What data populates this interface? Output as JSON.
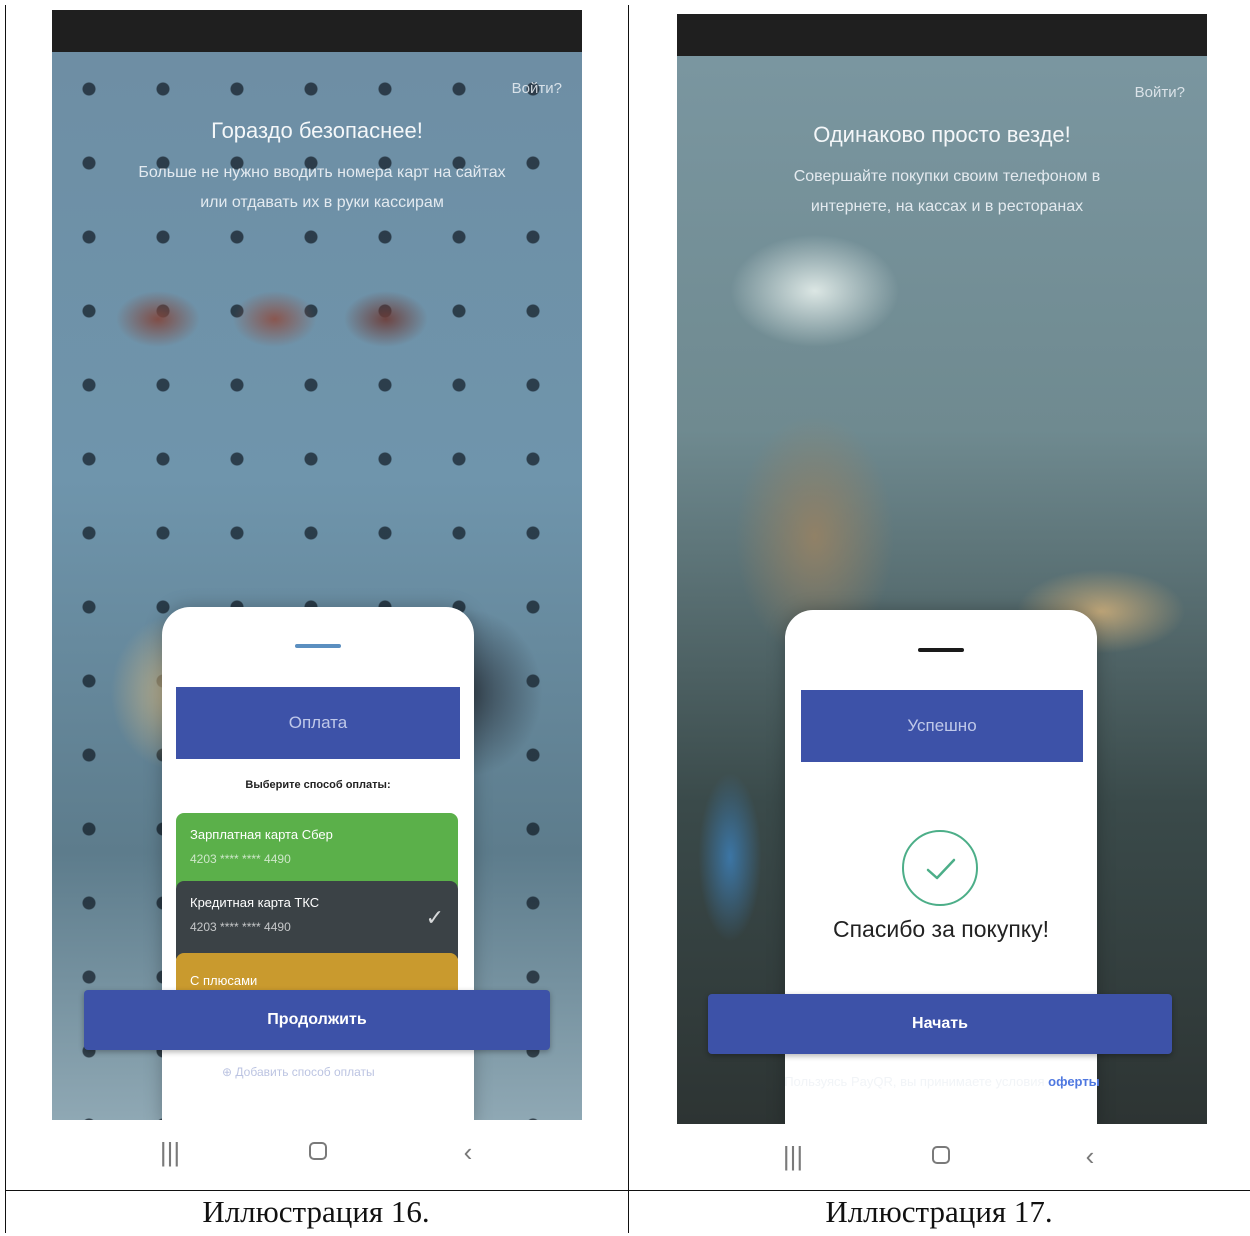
{
  "screen16": {
    "login_link": "Войти?",
    "headline": "Гораздо безопаснее!",
    "subtext": "Больше не нужно вводить номера карт на сайтах или отдавать их в руки кассирам",
    "app_bar_title": "Оплата",
    "select_label": "Выберите способ оплаты:",
    "cards": [
      {
        "name": "Зарплатная карта Сбер",
        "number": "4203 **** **** 4490",
        "color": "#5bb04a"
      },
      {
        "name": "Кредитная карта ТКС",
        "number": "4203 **** **** 4490",
        "color": "#3b4246",
        "selected": true
      },
      {
        "name": "С плюсами",
        "number": "",
        "color": "#c99a2e"
      }
    ],
    "continue_button": "Продолжить",
    "add_method": "Добавить способ оплаты",
    "caption": "Иллюстрация 16."
  },
  "screen17": {
    "login_link": "Войти?",
    "headline": "Одинаково просто везде!",
    "subtext": "Совершайте покупки своим телефоном в интернете, на кассах и в ресторанах",
    "app_bar_title": "Успешно",
    "thanks_message": "Спасибо за покупку!",
    "start_button": "Начать",
    "terms_prefix": "Пользуясь PayQR, вы принимаете условия",
    "terms_link": "оферты",
    "caption": "Иллюстрация 17."
  },
  "colors": {
    "brand_blue": "#3d52a8",
    "success_green": "#4cae88",
    "status_bar": "#1f1f1f"
  },
  "icons": {
    "check": "check-icon",
    "nav_recents": "recents-icon",
    "nav_home": "home-icon",
    "nav_back": "back-icon"
  }
}
